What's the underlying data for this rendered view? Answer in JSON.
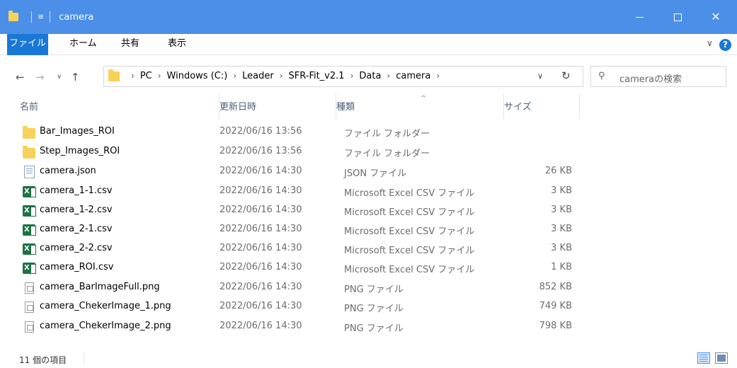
{
  "window": {
    "title": "camera",
    "qat_arrow": "≡",
    "minimize_glyph": "",
    "close_glyph": "✕"
  },
  "ribbon": {
    "tabs": [
      {
        "label": "ファイル",
        "active": true
      },
      {
        "label": "ホーム"
      },
      {
        "label": "共有"
      },
      {
        "label": "表示"
      }
    ],
    "expand_glyph": "∨",
    "help_glyph": "?"
  },
  "nav": {
    "back": "←",
    "forward": "→",
    "recent": "∨",
    "up": "↑"
  },
  "address": {
    "breadcrumbs": [
      "PC",
      "Windows (C:)",
      "Leader",
      "SFR-Fit_v2.1",
      "Data",
      "camera"
    ],
    "separator": "›",
    "dropdown": "∨",
    "refresh": "↻"
  },
  "search": {
    "placeholder": "cameraの検索",
    "icon": "search-icon"
  },
  "columns": {
    "name": "名前",
    "date": "更新日時",
    "type": "種類",
    "size": "サイズ",
    "sort_caret": "^"
  },
  "files": [
    {
      "name": "Bar_Images_ROI",
      "date": "2022/06/16 13:56",
      "type": "ファイル フォルダー",
      "size": "",
      "icon": "folder-icon"
    },
    {
      "name": "Step_Images_ROI",
      "date": "2022/06/16 13:56",
      "type": "ファイル フォルダー",
      "size": "",
      "icon": "folder-icon"
    },
    {
      "name": "camera.json",
      "date": "2022/06/16 14:30",
      "type": "JSON ファイル",
      "size": "26 KB",
      "icon": "json-file-icon"
    },
    {
      "name": "camera_1-1.csv",
      "date": "2022/06/16 14:30",
      "type": "Microsoft Excel CSV ファイル",
      "size": "3 KB",
      "icon": "excel-file-icon"
    },
    {
      "name": "camera_1-2.csv",
      "date": "2022/06/16 14:30",
      "type": "Microsoft Excel CSV ファイル",
      "size": "3 KB",
      "icon": "excel-file-icon"
    },
    {
      "name": "camera_2-1.csv",
      "date": "2022/06/16 14:30",
      "type": "Microsoft Excel CSV ファイル",
      "size": "3 KB",
      "icon": "excel-file-icon"
    },
    {
      "name": "camera_2-2.csv",
      "date": "2022/06/16 14:30",
      "type": "Microsoft Excel CSV ファイル",
      "size": "3 KB",
      "icon": "excel-file-icon"
    },
    {
      "name": "camera_ROI.csv",
      "date": "2022/06/16 14:30",
      "type": "Microsoft Excel CSV ファイル",
      "size": "1 KB",
      "icon": "excel-file-icon"
    },
    {
      "name": "camera_BarImageFull.png",
      "date": "2022/06/16 14:30",
      "type": "PNG ファイル",
      "size": "852 KB",
      "icon": "png-file-icon"
    },
    {
      "name": "camera_ChekerImage_1.png",
      "date": "2022/06/16 14:30",
      "type": "PNG ファイル",
      "size": "749 KB",
      "icon": "png-file-icon"
    },
    {
      "name": "camera_ChekerImage_2.png",
      "date": "2022/06/16 14:30",
      "type": "PNG ファイル",
      "size": "798 KB",
      "icon": "png-file-icon"
    }
  ],
  "status": {
    "item_count": "11 個の項目"
  },
  "colors": {
    "titlebar": "#4b8fe8",
    "file_tab": "#1978d6",
    "folder": "#f7d25a",
    "excel": "#1e7145"
  }
}
